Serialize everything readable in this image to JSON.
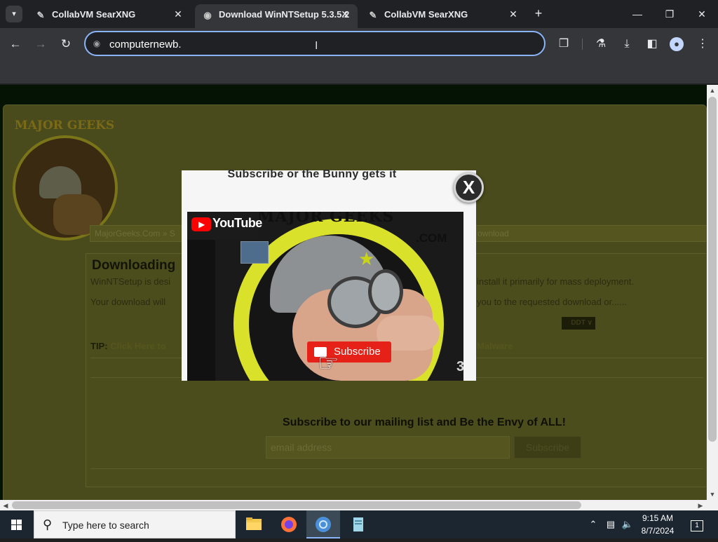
{
  "browser": {
    "tabs": [
      {
        "title": "CollabVM SearXNG",
        "active": false
      },
      {
        "title": "Download WinNTSetup 5.3.5.2",
        "active": true
      },
      {
        "title": "CollabVM SearXNG",
        "active": false
      }
    ],
    "address_value": "computernewb.",
    "accent_color": "#8ab4f8"
  },
  "site": {
    "logo_text": "MAJOR GEEKS",
    "breadcrumb_left": "MajorGeeks.Com » S",
    "breadcrumb_right": "ownload",
    "heading": "Downloading",
    "line1_left": "WinNTSetup is desi",
    "line1_right": "install it primarily for mass deployment.",
    "line2_left": "Your download will",
    "line2_right": "you to the requested download or......",
    "alt_button": "DDT",
    "tip_label": "TIP:",
    "tip_link": "Click Here to",
    "malware_text": "Malware",
    "mailing_title": "Subscribe to our mailing list and Be the Envy of ALL!",
    "email_placeholder": "email address",
    "subscribe_button": "Subscribe"
  },
  "popup": {
    "title": "Subscribe or the Bunny gets it",
    "close_label": "X",
    "youtube_label": "YouTube",
    "video_title": "MAJOR GEEKS",
    "video_com": ".COM",
    "subscribe_label": "Subscribe",
    "corner_number": "3"
  },
  "taskbar": {
    "search_placeholder": "Type here to search",
    "time": "9:15 AM",
    "date": "8/7/2024",
    "notification_count": "1"
  }
}
